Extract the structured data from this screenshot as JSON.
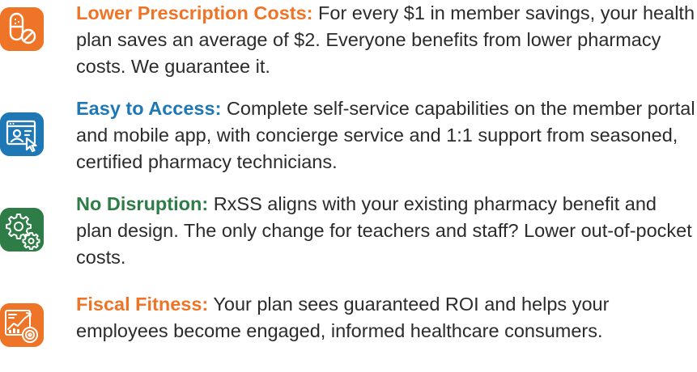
{
  "benefits": [
    {
      "label": "Lower Prescription Costs:",
      "text": " For every $1 in member savings, your health plan saves an average of $2. Everyone benefits from lower pharmacy costs. We guarantee it.",
      "icon": "pill-icon",
      "color": "#ee7527"
    },
    {
      "label": "Easy to Access:",
      "text": " Complete self-service capabilities on the member portal and mobile app, with concierge service and 1:1 support from seasoned, certified pharmacy technicians.",
      "icon": "portal-icon",
      "color": "#1d78b5"
    },
    {
      "label": "No Disruption:",
      "text": " RxSS aligns with your existing pharmacy benefit and plan design. The only change for teachers and staff? Lower out-of-pocket costs.",
      "icon": "gears-icon",
      "color": "#2e7d47"
    },
    {
      "label": "Fiscal Fitness:",
      "text": " Your plan sees guaranteed ROI and helps your employees become engaged, informed healthcare consumers.",
      "icon": "financial-chart-icon",
      "color": "#ee7527"
    }
  ]
}
